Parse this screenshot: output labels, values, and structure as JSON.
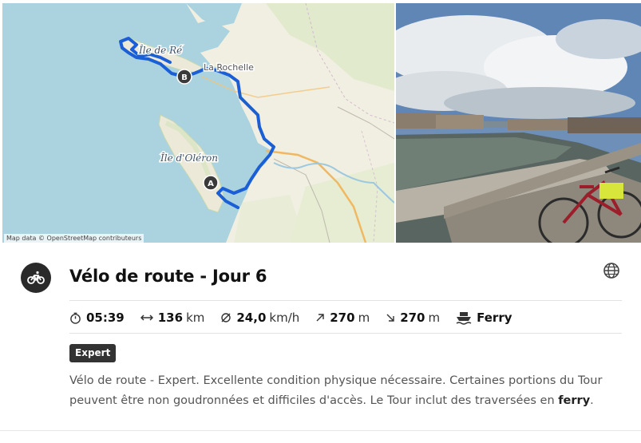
{
  "map": {
    "labels": {
      "ile_de_re": "Île de Ré",
      "la_rochelle": "La Rochelle",
      "ile_oleron": "Île d'Oléron"
    },
    "start_marker": "A",
    "end_marker": "B",
    "attribution": "Map data © OpenStreetMap contributeurs",
    "route_color": "#1b5fd6"
  },
  "photo": {
    "icon": "photo-icon"
  },
  "tour": {
    "sport_icon": "road-bike-icon",
    "title": "Vélo de route - Jour 6",
    "language_icon": "globe-icon",
    "stats": {
      "duration": "05:39",
      "distance_value": "136",
      "distance_unit": "km",
      "speed_value": "24,0",
      "speed_unit": "km/h",
      "ascent_value": "270",
      "ascent_unit": "m",
      "descent_value": "270",
      "descent_unit": "m",
      "ferry_label": "Ferry"
    },
    "difficulty": "Expert",
    "description_part1": "Vélo de route - Expert. Excellente condition physique nécessaire. Certaines portions du Tour peuvent être non goudronnées et difficiles d'accès. Le Tour inclut des traversées en ",
    "description_bold": "ferry",
    "description_end": "."
  },
  "colors": {
    "badge_bg": "#333333",
    "water": "#a9d2ea",
    "land": "#f1efe1"
  }
}
